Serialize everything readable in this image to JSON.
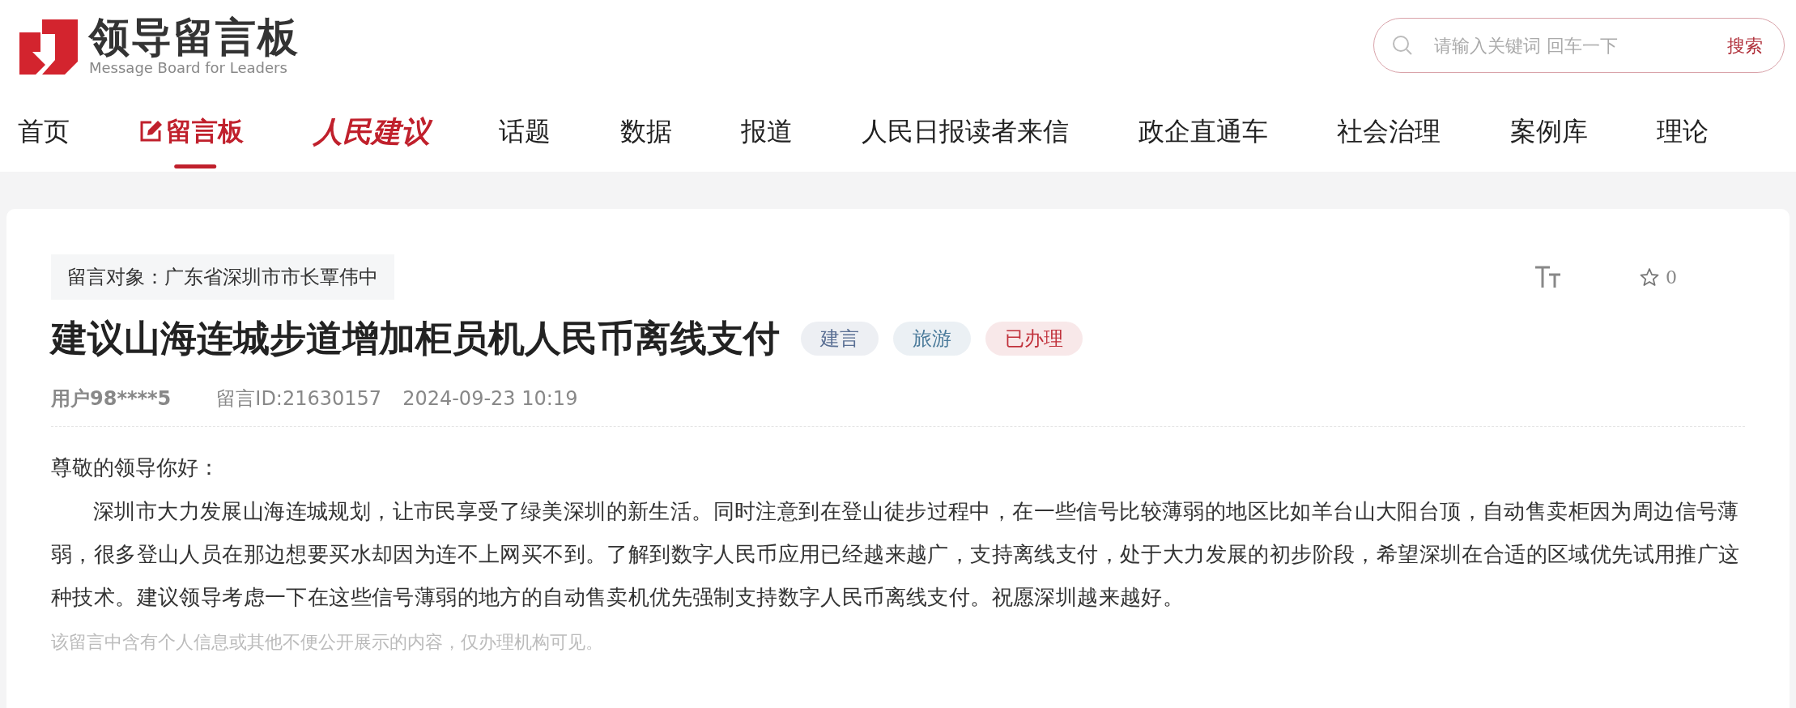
{
  "header": {
    "logo": {
      "title": "领导留言板",
      "subtitle": "Message Board for Leaders"
    },
    "search": {
      "placeholder": "请输入关键词 回车一下",
      "button": "搜索"
    }
  },
  "nav": [
    {
      "label": "首页",
      "kind": "text",
      "selected": false
    },
    {
      "label": "留言板",
      "kind": "icon-text",
      "selected": true
    },
    {
      "label": "人民建议",
      "kind": "brand",
      "selected": false
    },
    {
      "label": "话题",
      "kind": "text",
      "selected": false
    },
    {
      "label": "数据",
      "kind": "text",
      "selected": false
    },
    {
      "label": "报道",
      "kind": "text",
      "selected": false
    },
    {
      "label": "人民日报读者来信",
      "kind": "text",
      "selected": false
    },
    {
      "label": "政企直通车",
      "kind": "text",
      "selected": false
    },
    {
      "label": "社会治理",
      "kind": "text",
      "selected": false
    },
    {
      "label": "案例库",
      "kind": "text",
      "selected": false
    },
    {
      "label": "理论",
      "kind": "text",
      "selected": false
    }
  ],
  "message": {
    "target": "留言对象：广东省深圳市市长覃伟中",
    "favorites": "0",
    "title": "建议山海连城步道增加柜员机人民币离线支付",
    "tags": [
      {
        "label": "建言",
        "color": "#5a6f94"
      },
      {
        "label": "旅游",
        "color": "#4a7a9a"
      },
      {
        "label": "已办理",
        "color": "#c0303a"
      }
    ],
    "user": "用户98****5",
    "id": "留言ID:21630157",
    "time": "2024-09-23 10:19",
    "greeting": "尊敬的领导你好：",
    "body": "深圳市大力发展山海连城规划，让市民享受了绿美深圳的新生活。同时注意到在登山徒步过程中，在一些信号比较薄弱的地区比如羊台山大阳台顶，自动售卖柜因为周边信号薄弱，很多登山人员在那边想要买水却因为连不上网买不到。了解到数字人民币应用已经越来越广，支持离线支付，处于大力发展的初步阶段，希望深圳在合适的区域优先试用推广这种技术。建议领导考虑一下在这些信号薄弱的地方的自动售卖机优先强制支持数字人民币离线支付。祝愿深圳越来越好。",
    "note": "该留言中含有个人信息或其他不便公开展示的内容，仅办理机构可见。"
  }
}
